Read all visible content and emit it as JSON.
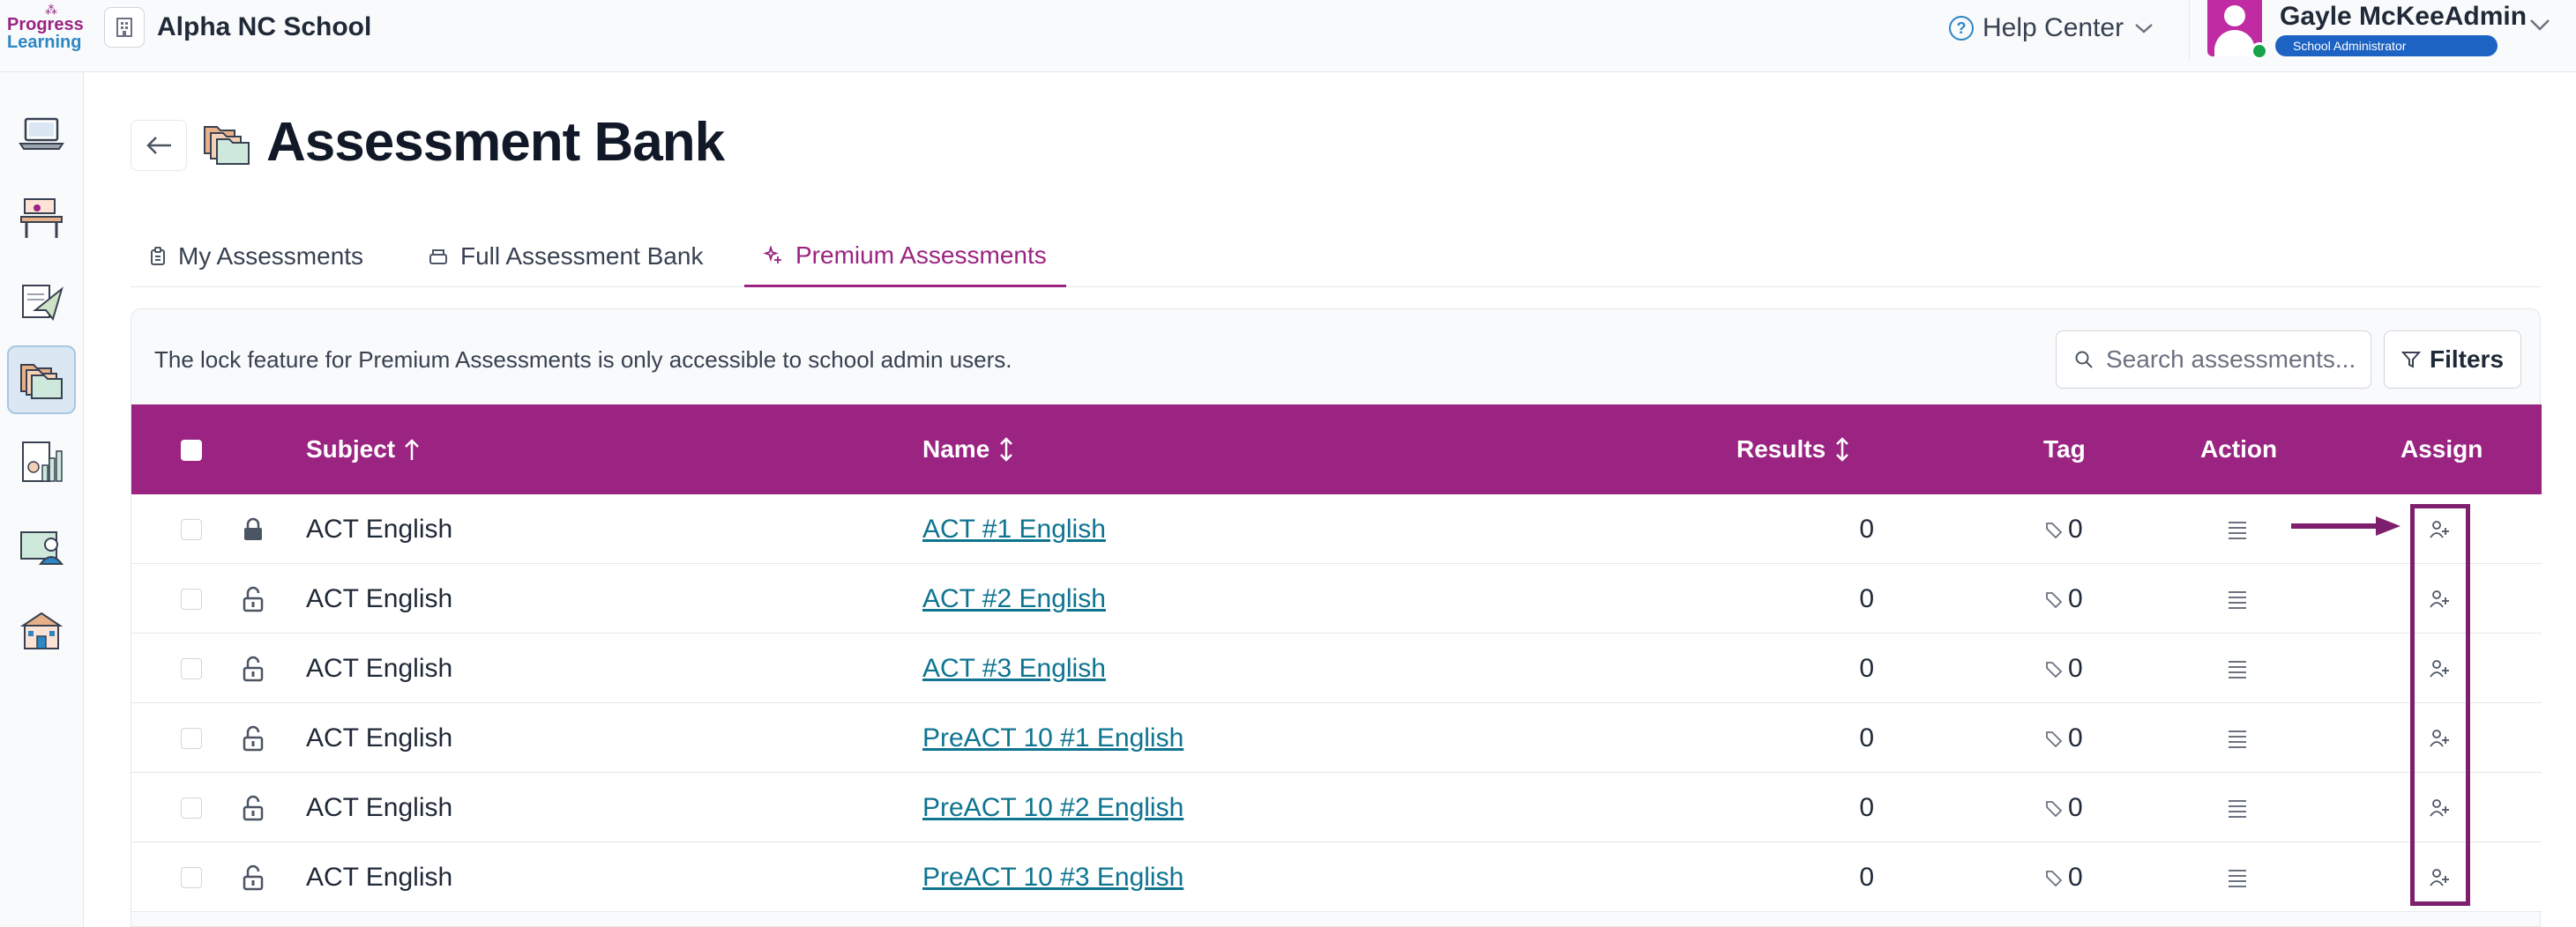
{
  "app": {
    "logo_line1": "Progress",
    "logo_line2": "Learning",
    "school_name": "Alpha NC School",
    "help_center": "Help Center",
    "user_name": "Gayle McKeeAdmin",
    "user_role": "School Administrator"
  },
  "sidebar": {
    "items": [
      {
        "icon": "laptop-icon",
        "active": false
      },
      {
        "icon": "classroom-desk-icon",
        "active": false
      },
      {
        "icon": "paper-plane-assignment-icon",
        "active": false
      },
      {
        "icon": "folders-assessment-icon",
        "active": true
      },
      {
        "icon": "report-chart-icon",
        "active": false
      },
      {
        "icon": "teacher-board-icon",
        "active": false
      },
      {
        "icon": "school-building-icon",
        "active": false
      }
    ]
  },
  "page": {
    "title": "Assessment Bank",
    "tabs": [
      {
        "label": "My Assessments",
        "active": false
      },
      {
        "label": "Full Assessment Bank",
        "active": false
      },
      {
        "label": "Premium Assessments",
        "active": true
      }
    ],
    "notice": "The lock feature for Premium Assessments is only accessible to school admin users.",
    "search_placeholder": "Search assessments...",
    "filters_label": "Filters"
  },
  "table": {
    "columns": {
      "subject": "Subject",
      "name": "Name",
      "results": "Results",
      "tag": "Tag",
      "action": "Action",
      "assign": "Assign"
    },
    "rows": [
      {
        "locked": true,
        "subject": "ACT English",
        "name": "ACT #1 English",
        "results": "0",
        "tag": "0"
      },
      {
        "locked": false,
        "subject": "ACT English",
        "name": "ACT #2 English",
        "results": "0",
        "tag": "0"
      },
      {
        "locked": false,
        "subject": "ACT English",
        "name": "ACT #3 English",
        "results": "0",
        "tag": "0"
      },
      {
        "locked": false,
        "subject": "ACT English",
        "name": "PreACT 10 #1 English",
        "results": "0",
        "tag": "0"
      },
      {
        "locked": false,
        "subject": "ACT English",
        "name": "PreACT 10 #2 English",
        "results": "0",
        "tag": "0"
      },
      {
        "locked": false,
        "subject": "ACT English",
        "name": "PreACT 10 #3 English",
        "results": "0",
        "tag": "0"
      }
    ]
  },
  "colors": {
    "brand_purple": "#9b2482",
    "link_teal": "#0e7490",
    "highlight_outline": "#7e1f6d",
    "role_badge_blue": "#1d63c3"
  }
}
